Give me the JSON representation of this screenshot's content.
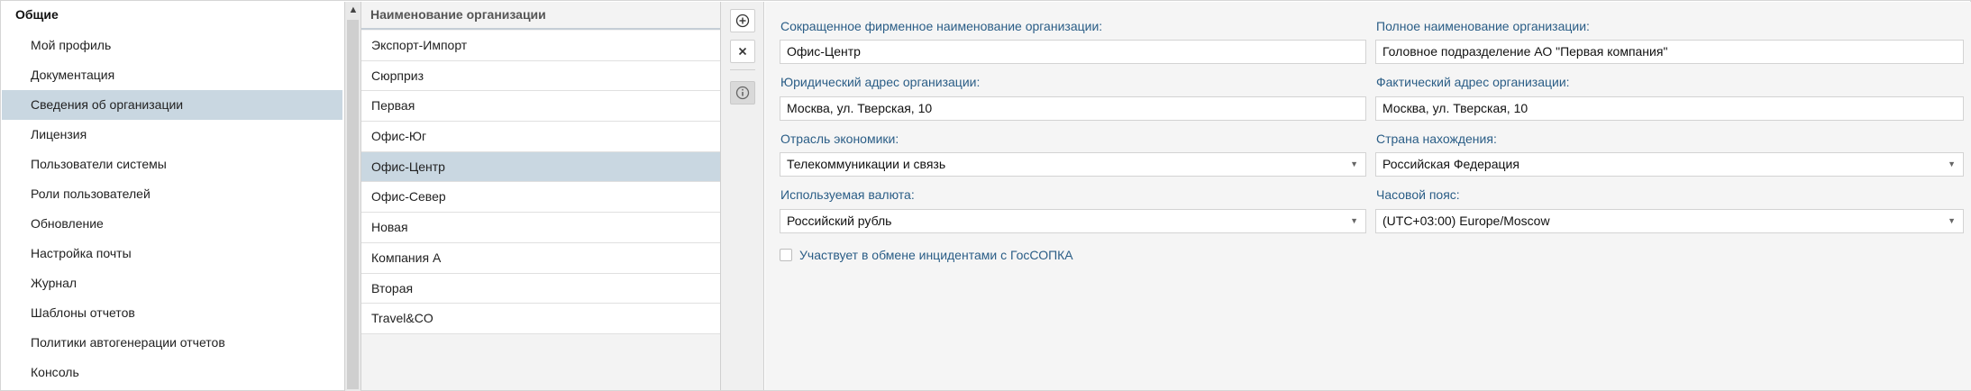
{
  "nav": {
    "title": "Общие",
    "items": [
      {
        "label": "Мой профиль",
        "active": false
      },
      {
        "label": "Документация",
        "active": false
      },
      {
        "label": "Сведения об организации",
        "active": true
      },
      {
        "label": "Лицензия",
        "active": false
      },
      {
        "label": "Пользователи системы",
        "active": false
      },
      {
        "label": "Роли пользователей",
        "active": false
      },
      {
        "label": "Обновление",
        "active": false
      },
      {
        "label": "Настройка почты",
        "active": false
      },
      {
        "label": "Журнал",
        "active": false
      },
      {
        "label": "Шаблоны отчетов",
        "active": false
      },
      {
        "label": "Политики автогенерации отчетов",
        "active": false
      },
      {
        "label": "Консоль",
        "active": false
      }
    ]
  },
  "orgs": {
    "header": "Наименование организации",
    "items": [
      {
        "name": "Экспорт-Импорт",
        "active": false
      },
      {
        "name": "Сюрприз",
        "active": false
      },
      {
        "name": "Первая",
        "active": false
      },
      {
        "name": "Офис-Юг",
        "active": false
      },
      {
        "name": "Офис-Центр",
        "active": true
      },
      {
        "name": "Офис-Север",
        "active": false
      },
      {
        "name": "Новая",
        "active": false
      },
      {
        "name": "Компания А",
        "active": false
      },
      {
        "name": "Вторая",
        "active": false
      },
      {
        "name": "Travel&CO",
        "active": false
      }
    ]
  },
  "toolbar": {
    "add_icon": "plus-circle-icon",
    "delete_icon": "close-icon",
    "info_icon": "info-icon"
  },
  "form": {
    "short_name_label": "Сокращенное фирменное наименование организации:",
    "short_name_value": "Офис-Центр",
    "full_name_label": "Полное наименование организации:",
    "full_name_value": "Головное подразделение АО \"Первая компания\"",
    "legal_address_label": "Юридический адрес организации:",
    "legal_address_value": "Москва, ул. Тверская, 10",
    "actual_address_label": "Фактический адрес организации:",
    "actual_address_value": "Москва, ул. Тверская, 10",
    "industry_label": "Отрасль экономики:",
    "industry_value": "Телекоммуникации и связь",
    "country_label": "Страна нахождения:",
    "country_value": "Российская Федерация",
    "currency_label": "Используемая валюта:",
    "currency_value": "Российский рубль",
    "timezone_label": "Часовой пояс:",
    "timezone_value": "(UTC+03:00) Europe/Moscow",
    "gossopka_label": "Участвует в обмене инцидентами с ГосСОПКА",
    "gossopka_checked": false
  },
  "colors": {
    "selected_row": "#c9d7e1",
    "label_blue": "#2a5d86",
    "panel_bg": "#f5f5f5"
  }
}
